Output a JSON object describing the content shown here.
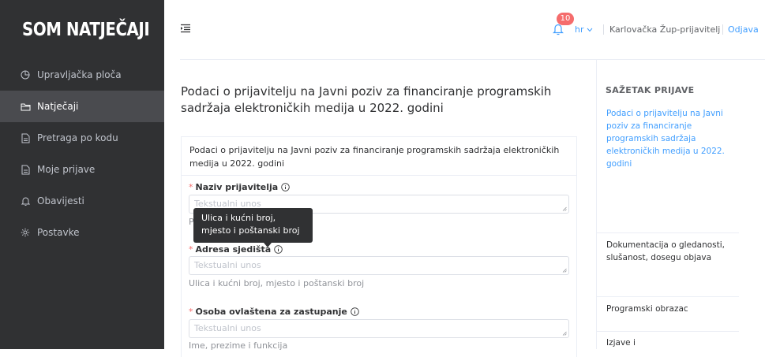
{
  "brand": {
    "name": "SOM NATJEČAJI"
  },
  "sidebar": {
    "items": [
      {
        "label": "Upravljačka ploča",
        "icon": "dashboard-icon"
      },
      {
        "label": "Natječaji",
        "icon": "folder-icon",
        "active": true
      },
      {
        "label": "Pretraga po kodu",
        "icon": "document-icon"
      },
      {
        "label": "Moje prijave",
        "icon": "document-icon"
      },
      {
        "label": "Obavijesti",
        "icon": "bell-icon"
      },
      {
        "label": "Postavke",
        "icon": "gear-icon"
      }
    ]
  },
  "topbar": {
    "notification_count": "10",
    "language": "hr",
    "user": "Karlovačka Žup-prijavitelj",
    "logout": "Odjava"
  },
  "page": {
    "title": "Podaci o prijavitelju na Javni poziv za financiranje programskih sadržaja elektroničkih medija u 2022. godini"
  },
  "form": {
    "header": "Podaci o prijavitelju na Javni poziv za financiranje programskih sadržaja elektroničkih medija u 2022. godini",
    "fields": [
      {
        "label": "Naziv prijavitelja",
        "placeholder": "Tekstualni unos",
        "hint": "P"
      },
      {
        "label": "Adresa sjedišta",
        "placeholder": "Tekstualni unos",
        "hint": "Ulica i kućni broj, mjesto i poštanski broj"
      },
      {
        "label": "Osoba ovlaštena za zastupanje",
        "placeholder": "Tekstualni unos",
        "hint": "Ime, prezime i funkcija"
      }
    ],
    "tooltip": "Ulica i kućni broj, mjesto i poštanski broj"
  },
  "summary": {
    "title": "SAŽETAK PRIJAVE",
    "items": [
      {
        "label": "Podaci o prijavitelju na Javni poziv za financiranje programskih sadržaja elektroničkih medija u 2022. godini",
        "active": true
      },
      {
        "label": "Dokumentacija o gledanosti, slušanost, dosegu objava"
      },
      {
        "label": "Programski obrazac"
      },
      {
        "label": "Izjave i"
      }
    ]
  },
  "colors": {
    "sidebar": "#303133",
    "accent": "#409eff",
    "required": "#f56c6c"
  }
}
